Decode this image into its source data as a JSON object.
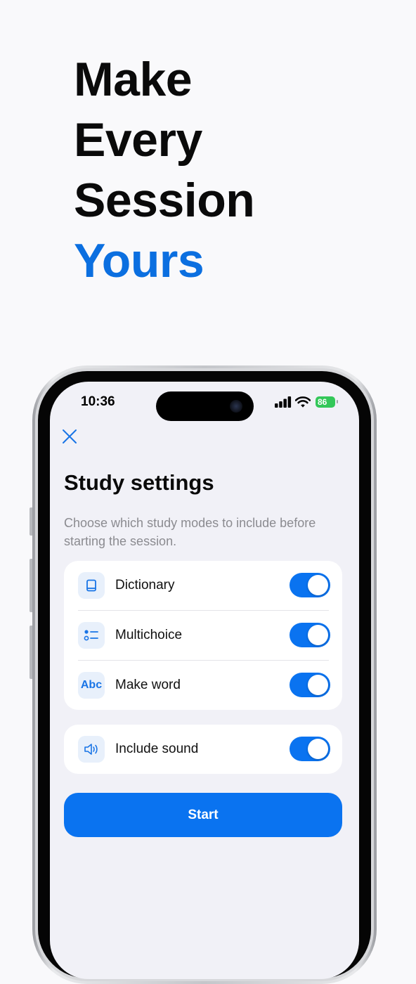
{
  "headline": {
    "line1": "Make",
    "line2": "Every",
    "line3": "Session",
    "line4_accent": "Yours"
  },
  "colors": {
    "accent": "#0b6fe0",
    "toggle_on": "#0a73f0",
    "battery_green": "#33c759",
    "screen_bg": "#f1f1f7"
  },
  "status_bar": {
    "time": "10:36",
    "battery_level": "86",
    "icons": [
      "signal-icon",
      "wifi-icon",
      "battery-icon"
    ]
  },
  "screen": {
    "close_icon": "close-icon",
    "title": "Study settings",
    "subtitle": "Choose which study modes to include before starting the session.",
    "modes": [
      {
        "label": "Dictionary",
        "icon": "book-icon",
        "enabled": true
      },
      {
        "label": "Multichoice",
        "icon": "list-icon",
        "icon_text": "",
        "enabled": true
      },
      {
        "label": "Make word",
        "icon": "abc-icon",
        "icon_text": "Abc",
        "enabled": true
      }
    ],
    "sound": {
      "label": "Include sound",
      "icon": "speaker-icon",
      "enabled": true
    },
    "start_label": "Start"
  }
}
